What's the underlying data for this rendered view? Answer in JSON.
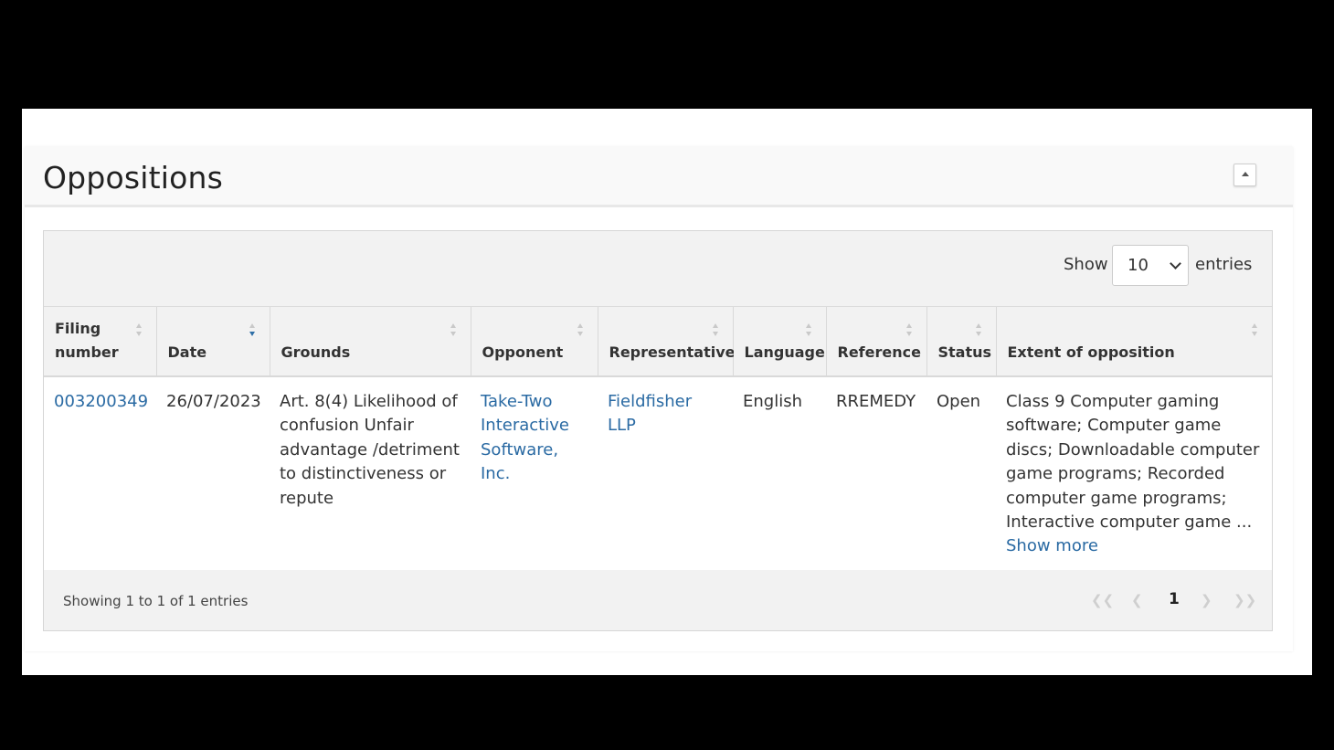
{
  "panel": {
    "title": "Oppositions",
    "collapse_icon": "caret-up-icon"
  },
  "toolbar": {
    "show_label": "Show",
    "entries_value": "10",
    "entries_label": "entries"
  },
  "table": {
    "columns": [
      {
        "label": "Filing number",
        "sort": "none"
      },
      {
        "label": "Date",
        "sort": "descending"
      },
      {
        "label": "Grounds",
        "sort": "none"
      },
      {
        "label": "Opponent",
        "sort": "none"
      },
      {
        "label": "Representative",
        "sort": "none"
      },
      {
        "label": "Language",
        "sort": "none"
      },
      {
        "label": "Reference",
        "sort": "none"
      },
      {
        "label": "Status",
        "sort": "none"
      },
      {
        "label": "Extent of opposition",
        "sort": "none"
      }
    ],
    "rows": [
      {
        "filing_number": "003200349",
        "date": "26/07/2023",
        "grounds": "Art. 8(4) Likelihood of confusion Unfair advantage /detriment to distinctiveness or repute",
        "opponent": "Take-Two Interactive Software, Inc.",
        "representative": "Fieldfisher LLP",
        "language": "English",
        "reference": "RREMEDY",
        "status": "Open",
        "extent": "Class 9 Computer gaming software; Computer game discs; Downloadable computer game programs; Recorded computer game programs; Interactive computer game ...",
        "show_more": "Show more"
      }
    ]
  },
  "footer": {
    "info": "Showing 1 to 1 of 1 entries",
    "pagination": {
      "first_icon": "double-chevron-left-icon",
      "prev_icon": "chevron-left-icon",
      "current_page": "1",
      "next_icon": "chevron-right-icon",
      "last_icon": "double-chevron-right-icon"
    }
  },
  "colors": {
    "link": "#2a6aa3",
    "sort_active": "#2f6fa7",
    "header_bg": "#f2f2f2"
  }
}
